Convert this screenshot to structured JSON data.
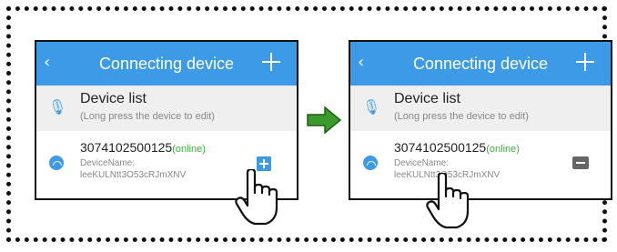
{
  "screens": [
    {
      "header": {
        "back_icon": "chevron-left-icon",
        "title": "Connecting device",
        "add_icon": "plus-icon"
      },
      "list_header": {
        "icon": "bluetooth-icon",
        "title": "Device list",
        "subtitle": "(Long press the device to edit)"
      },
      "device": {
        "icon": "wifi-icon",
        "id": "3074102500125",
        "status": "(online)",
        "name_label": "DeviceName:",
        "name_value": "leeKULNtt3O53cRJmXNV",
        "action": "add-device-button"
      }
    },
    {
      "header": {
        "back_icon": "chevron-left-icon",
        "title": "Connecting device",
        "add_icon": "plus-icon"
      },
      "list_header": {
        "icon": "bluetooth-icon",
        "title": "Device list",
        "subtitle": "(Long press the device to edit)"
      },
      "device": {
        "icon": "wifi-icon",
        "id": "3074102500125",
        "status": "(online)",
        "name_label": "DeviceName:",
        "name_value": "leeKULNtt3O53cRJmXNV",
        "action": "remove-device-button"
      }
    }
  ],
  "colors": {
    "header_blue": "#3d9ae6",
    "online_green": "#3cb043",
    "arrow_green": "#3a9a2c",
    "remove_gray": "#666666"
  }
}
